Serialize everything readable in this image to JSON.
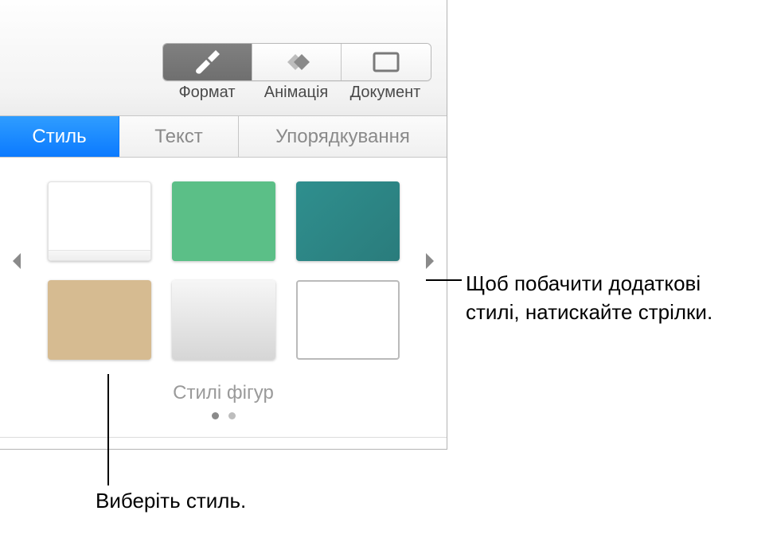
{
  "toolbar": {
    "format_label": "Формат",
    "animation_label": "Анімація",
    "document_label": "Документ"
  },
  "subtabs": {
    "style": "Стиль",
    "text": "Текст",
    "arrange": "Упорядкування"
  },
  "styles": {
    "section_label": "Стилі фігур",
    "swatches": [
      {
        "name": "white-paper",
        "color": "#ffffff"
      },
      {
        "name": "green",
        "color": "#5bbf87"
      },
      {
        "name": "teal",
        "color": "#2a7c7c"
      },
      {
        "name": "tan",
        "color": "#d6bb91"
      },
      {
        "name": "silver",
        "color": "#d6d6d6"
      },
      {
        "name": "outline",
        "color": "#ffffff"
      }
    ],
    "page_count": 2,
    "current_page": 1
  },
  "callouts": {
    "arrow_hint_line1": "Щоб побачити додаткові",
    "arrow_hint_line2": "стилі, натискайте стрілки.",
    "select_hint": "Виберіть стиль."
  }
}
